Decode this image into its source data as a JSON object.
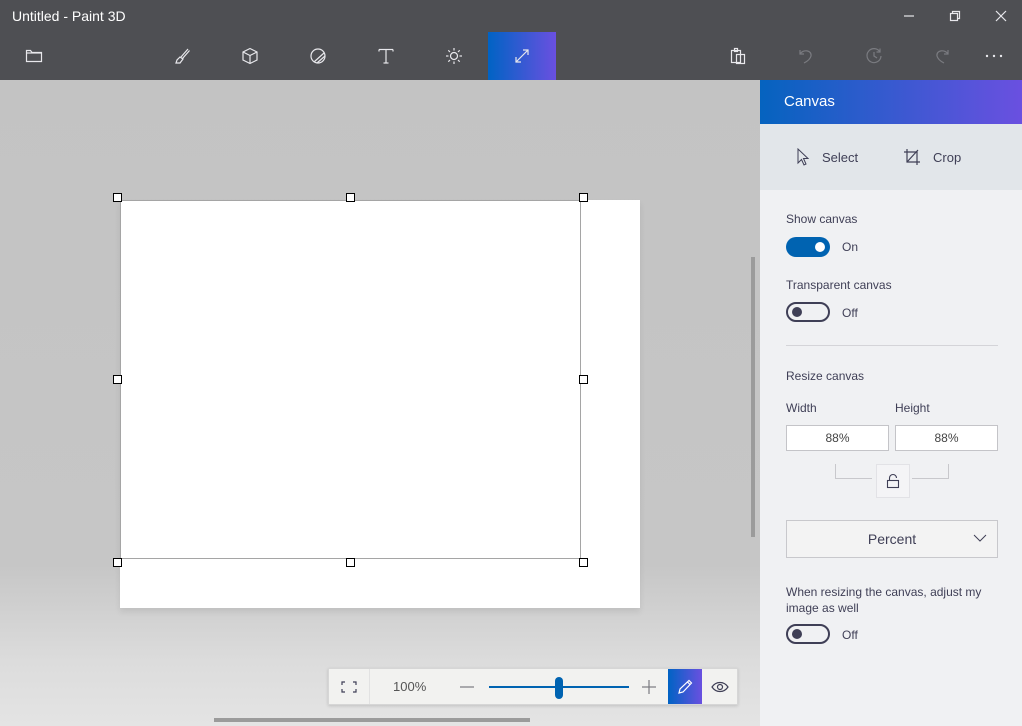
{
  "window": {
    "title": "Untitled - Paint 3D",
    "controls": [
      "minimize",
      "restore",
      "close"
    ]
  },
  "toolbar": {
    "left": [
      {
        "name": "menu",
        "icon": "folder-icon"
      }
    ],
    "tools": [
      {
        "name": "brushes",
        "icon": "brush-icon",
        "active": false
      },
      {
        "name": "3d-shapes",
        "icon": "cube-icon",
        "active": false
      },
      {
        "name": "stickers",
        "icon": "sticker-icon",
        "active": false
      },
      {
        "name": "text",
        "icon": "text-icon",
        "active": false
      },
      {
        "name": "effects",
        "icon": "sun-icon",
        "active": false
      },
      {
        "name": "canvas",
        "icon": "resize-icon",
        "active": true
      }
    ],
    "right": [
      {
        "name": "paste",
        "icon": "paste-icon",
        "enabled": true
      },
      {
        "name": "undo",
        "icon": "undo-icon",
        "enabled": false
      },
      {
        "name": "history",
        "icon": "history-icon",
        "enabled": false
      },
      {
        "name": "redo",
        "icon": "redo-icon",
        "enabled": false
      },
      {
        "name": "more",
        "icon": "more-icon",
        "enabled": true
      }
    ]
  },
  "zoombar": {
    "zoom_label": "100%",
    "zoom_fraction": 0.5
  },
  "panel": {
    "title": "Canvas",
    "tools": {
      "select": "Select",
      "crop": "Crop"
    },
    "show_canvas": {
      "label": "Show canvas",
      "state": "On"
    },
    "transparent_canvas": {
      "label": "Transparent canvas",
      "state": "Off"
    },
    "resize": {
      "title": "Resize canvas",
      "width_label": "Width",
      "height_label": "Height",
      "width_value": "88%",
      "height_value": "88%",
      "unit": "Percent"
    },
    "adjust_image": {
      "label": "When resizing the canvas, adjust my image as well",
      "state": "Off"
    }
  },
  "colors": {
    "accent_start": "#0063c4",
    "accent_end": "#6a50e0",
    "toggle_on": "#0063b1",
    "titlebar": "#4e4f53"
  }
}
